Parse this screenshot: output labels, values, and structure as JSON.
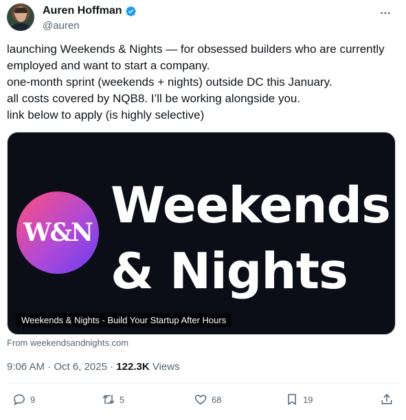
{
  "author": {
    "display_name": "Auren Hoffman",
    "handle": "@auren",
    "verified_color": "#1d9bf0"
  },
  "tweet": {
    "lines": [
      "launching Weekends & Nights — for obsessed builders who are currently",
      "employed and want to start a company.",
      "one-month sprint (weekends + nights) outside DC this January.",
      "all costs covered by NQB8. I’ll be working alongside you.",
      "link below to apply (is highly selective)"
    ]
  },
  "card": {
    "logo_text": "W&N",
    "title_line1": "Weekends",
    "title_line2": "& Nights",
    "caption": "Weekends & Nights - Build Your Startup After Hours",
    "from": "From weekendsandnights.com"
  },
  "meta": {
    "time": "9:06 AM",
    "date": "Oct 6, 2025",
    "views_count": "122.3K",
    "views_label": "Views"
  },
  "actions": {
    "replies": "9",
    "reposts": "5",
    "likes": "68",
    "bookmarks": "19"
  },
  "icons": {
    "more": "more-horizontal-icon",
    "verified": "verified-badge-icon",
    "reply": "reply-icon",
    "repost": "repost-icon",
    "like": "heart-icon",
    "bookmark": "bookmark-icon",
    "share": "share-icon"
  }
}
